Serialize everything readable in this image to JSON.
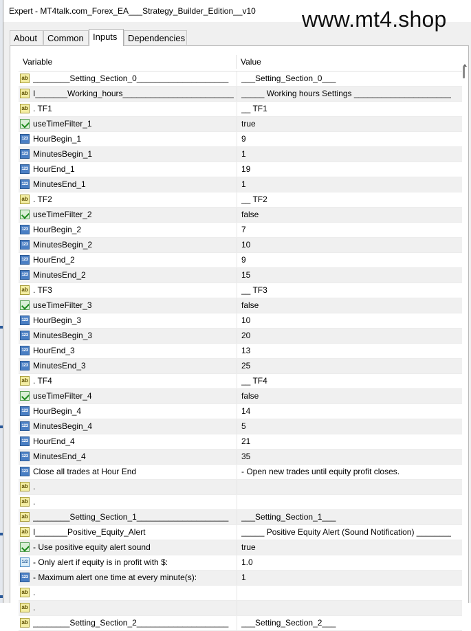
{
  "window": {
    "title": "Expert - MT4talk.com_Forex_EA___Strategy_Builder_Edition__v10"
  },
  "watermark": "www.mt4.shop",
  "tabs": [
    {
      "label": "About"
    },
    {
      "label": "Common"
    },
    {
      "label": "Inputs",
      "active": true
    },
    {
      "label": "Dependencies"
    }
  ],
  "table": {
    "columns": [
      "Variable",
      "Value"
    ],
    "rows": [
      {
        "type": "ab",
        "variable": "________Setting_Section_0____________________",
        "value": "___Setting_Section_0___"
      },
      {
        "type": "ab",
        "variable": "I_______Working_hours_____________________________________",
        "value": "_____ Working hours Settings ______________________"
      },
      {
        "type": "ab",
        "variable": ". TF1",
        "value": "__ TF1"
      },
      {
        "type": "bool",
        "variable": "useTimeFilter_1",
        "value": "true"
      },
      {
        "type": "int",
        "variable": "HourBegin_1",
        "value": "9"
      },
      {
        "type": "int",
        "variable": "MinutesBegin_1",
        "value": "1"
      },
      {
        "type": "int",
        "variable": "HourEnd_1",
        "value": "19"
      },
      {
        "type": "int",
        "variable": "MinutesEnd_1",
        "value": "1"
      },
      {
        "type": "ab",
        "variable": ". TF2",
        "value": "__ TF2"
      },
      {
        "type": "bool",
        "variable": "useTimeFilter_2",
        "value": "false"
      },
      {
        "type": "int",
        "variable": "HourBegin_2",
        "value": "7"
      },
      {
        "type": "int",
        "variable": "MinutesBegin_2",
        "value": "10"
      },
      {
        "type": "int",
        "variable": "HourEnd_2",
        "value": "9"
      },
      {
        "type": "int",
        "variable": "MinutesEnd_2",
        "value": "15"
      },
      {
        "type": "ab",
        "variable": ". TF3",
        "value": "__ TF3"
      },
      {
        "type": "bool",
        "variable": "useTimeFilter_3",
        "value": "false"
      },
      {
        "type": "int",
        "variable": "HourBegin_3",
        "value": "10"
      },
      {
        "type": "int",
        "variable": "MinutesBegin_3",
        "value": "20"
      },
      {
        "type": "int",
        "variable": "HourEnd_3",
        "value": "13"
      },
      {
        "type": "int",
        "variable": "MinutesEnd_3",
        "value": "25"
      },
      {
        "type": "ab",
        "variable": ". TF4",
        "value": "__ TF4"
      },
      {
        "type": "bool",
        "variable": "useTimeFilter_4",
        "value": "false"
      },
      {
        "type": "int",
        "variable": "HourBegin_4",
        "value": "14"
      },
      {
        "type": "int",
        "variable": "MinutesBegin_4",
        "value": "5"
      },
      {
        "type": "int",
        "variable": "HourEnd_4",
        "value": "21"
      },
      {
        "type": "int",
        "variable": "MinutesEnd_4",
        "value": "35"
      },
      {
        "type": "int",
        "variable": "Close all trades at Hour End",
        "value": "- Open new trades until equity profit closes."
      },
      {
        "type": "ab",
        "variable": ".",
        "value": ""
      },
      {
        "type": "ab",
        "variable": ".",
        "value": ""
      },
      {
        "type": "ab",
        "variable": "________Setting_Section_1____________________",
        "value": "___Setting_Section_1___"
      },
      {
        "type": "ab",
        "variable": "I_______Positive_Equity_Alert",
        "value": "_____ Positive Equity Alert (Sound Notification) ______________"
      },
      {
        "type": "bool",
        "variable": "- Use positive equity alert sound",
        "value": "true"
      },
      {
        "type": "dbl",
        "variable": "- Only alert if equity is in profit with $:",
        "value": "1.0"
      },
      {
        "type": "int",
        "variable": "- Maximum alert one time at every minute(s):",
        "value": "1"
      },
      {
        "type": "ab",
        "variable": ".",
        "value": ""
      },
      {
        "type": "ab",
        "variable": ".",
        "value": ""
      },
      {
        "type": "ab",
        "variable": "________Setting_Section_2____________________",
        "value": "___Setting_Section_2___"
      }
    ]
  },
  "icons": {
    "ab": "string-type-icon",
    "int": "integer-type-icon",
    "bool": "boolean-type-icon",
    "dbl": "double-type-icon"
  }
}
